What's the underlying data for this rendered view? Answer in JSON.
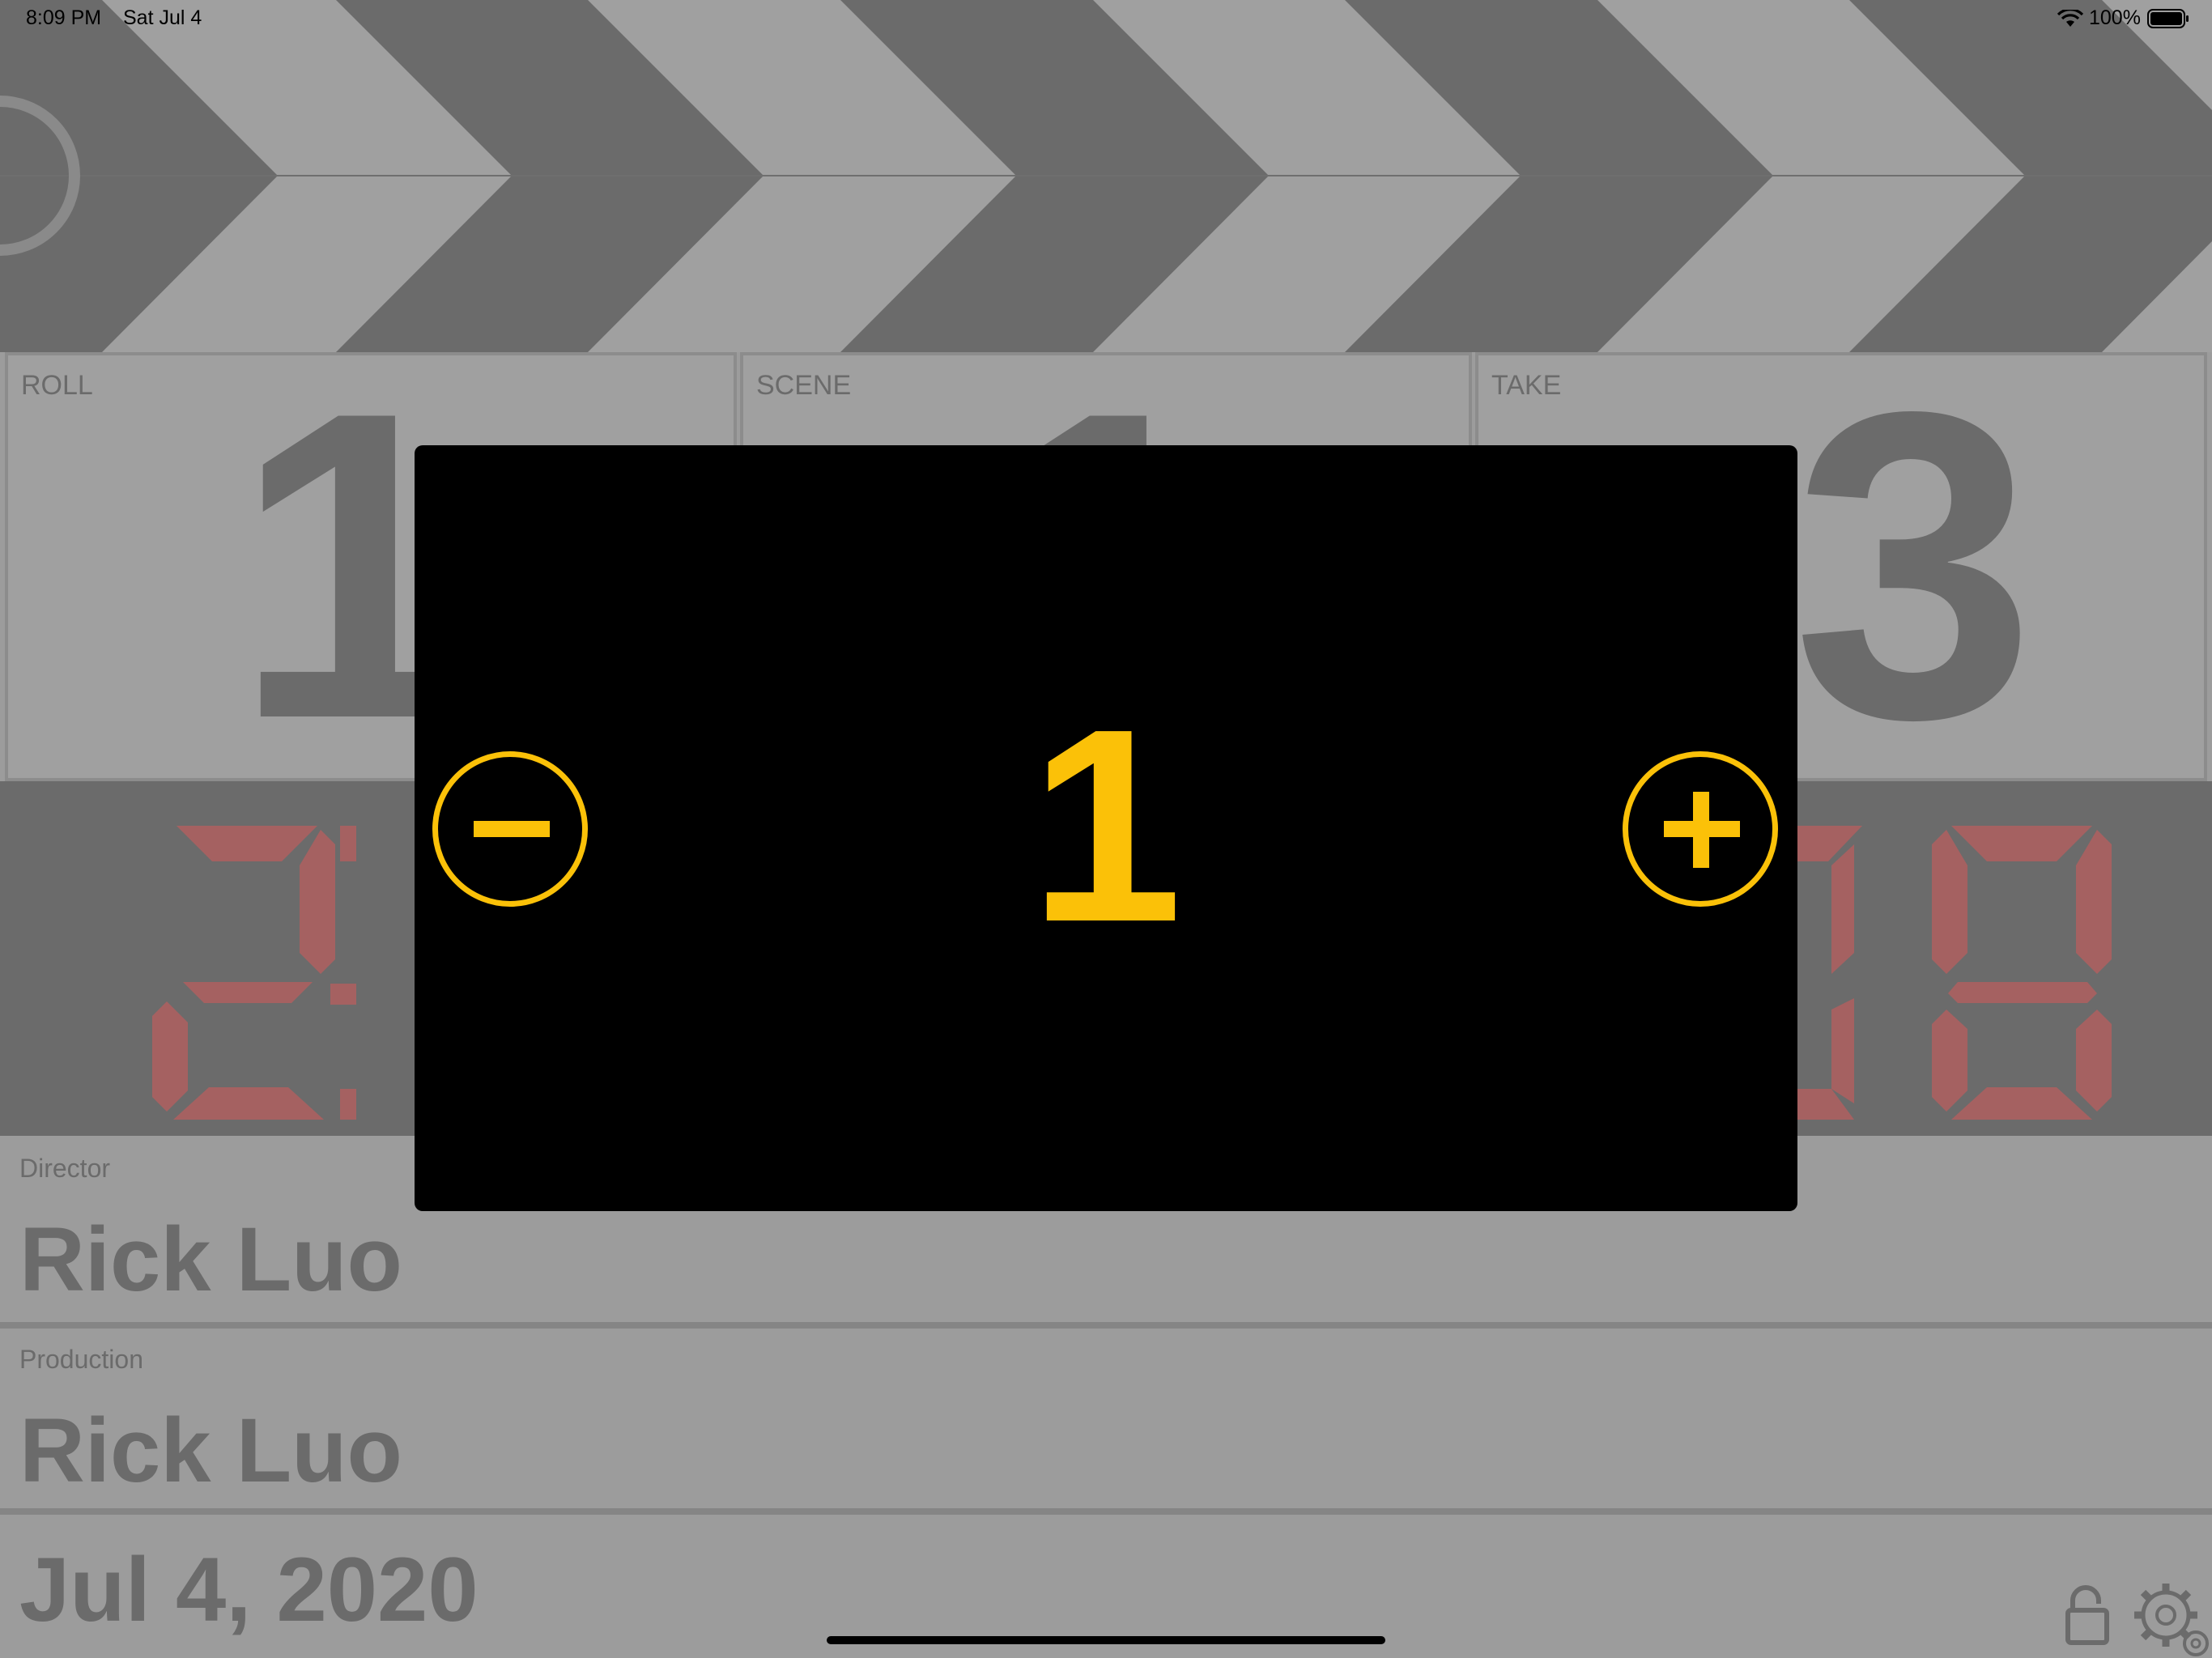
{
  "status_bar": {
    "time": "8:09 PM",
    "date": "Sat Jul 4",
    "battery": "100%"
  },
  "slate": {
    "roll": {
      "label": "ROLL",
      "value": "1"
    },
    "scene": {
      "label": "SCENE",
      "value": "1"
    },
    "take": {
      "label": "TAKE",
      "value": "3"
    },
    "timecode_digits": [
      "2",
      "8"
    ],
    "director": {
      "label": "Director",
      "value": "Rick Luo"
    },
    "production": {
      "label": "Production",
      "value": "Rick Luo"
    },
    "date": "Jul 4, 2020"
  },
  "stepper": {
    "value": "1"
  },
  "colors": {
    "accent": "#fbc108",
    "segment_red": "#a56161",
    "dim_gray": "#6b6b6b",
    "light_gray": "#9c9c9c"
  },
  "icons": [
    "wifi-icon",
    "battery-icon",
    "minus-circle-icon",
    "plus-circle-icon",
    "unlock-icon",
    "gear-icon"
  ]
}
